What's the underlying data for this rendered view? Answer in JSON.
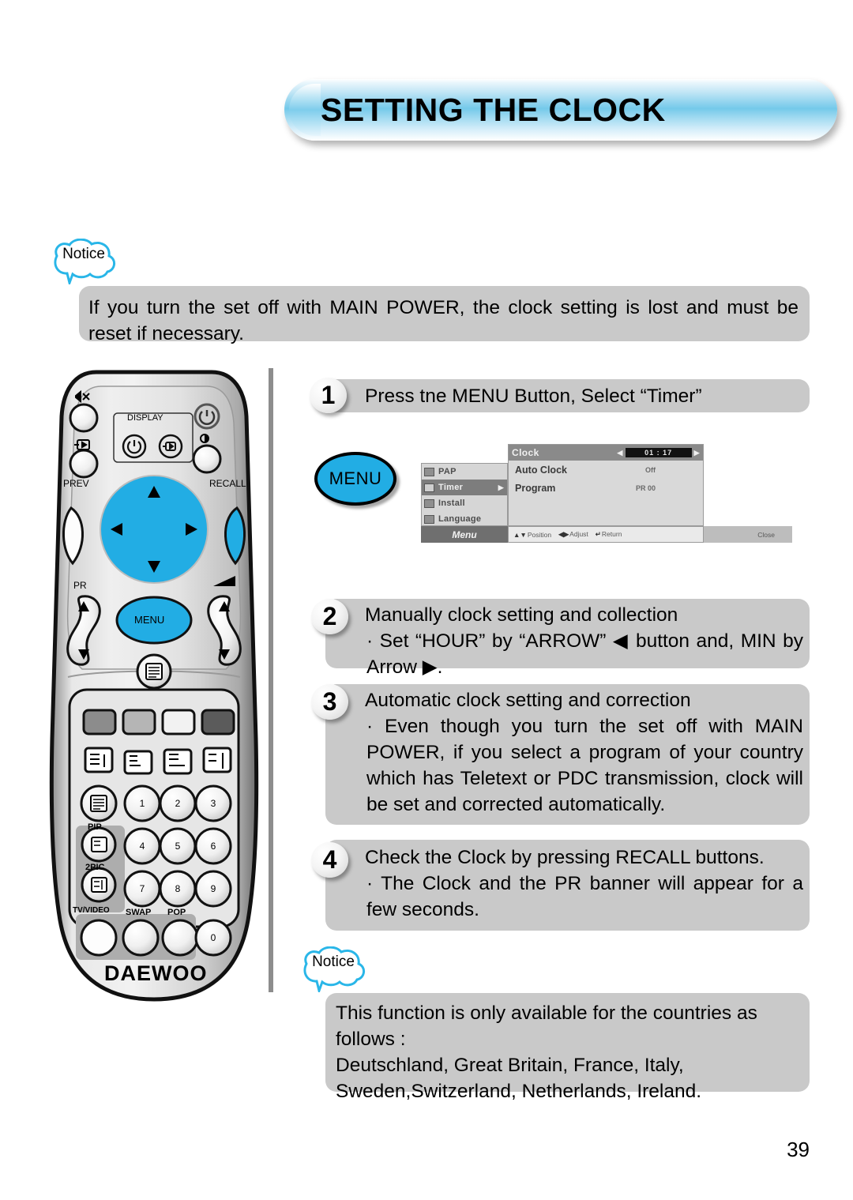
{
  "page": {
    "title": "SETTING THE CLOCK",
    "number": "39"
  },
  "notice_top": {
    "badge": "Notice",
    "text": "If you turn the set off with MAIN POWER, the clock setting is lost and must be reset if necessary."
  },
  "steps": [
    {
      "number": "1",
      "title": "Press tne MENU Button, Select “Timer”",
      "bullets": []
    },
    {
      "number": "2",
      "title": "Manually clock setting and collection",
      "bullets": [
        "· Set “HOUR” by “ARROW” ◀ button and, MIN by Arrow ▶."
      ]
    },
    {
      "number": "3",
      "title": "Automatic clock setting and correction",
      "bullets": [
        "· Even though you turn the set off with MAIN POWER, if you select a program of your country which has Teletext or PDC transmission, clock will be set  and corrected automatically."
      ]
    },
    {
      "number": "4",
      "title": "Check the Clock by pressing RECALL buttons.",
      "bullets": [
        "· The Clock and the PR banner will appear for a few seconds."
      ]
    }
  ],
  "notice_bottom": {
    "badge": "Notice",
    "line1": "This function is only available for the countries as follows :",
    "line2": "Deutschland, Great Britain, France, Italy,",
    "line3": "Sweden,Switzerland, Netherlands, Ireland."
  },
  "osd": {
    "menu_button_label": "MENU",
    "left_items": [
      {
        "label": "PAP",
        "selected": false,
        "submenu_arrow": ""
      },
      {
        "label": "Timer",
        "selected": true,
        "submenu_arrow": "▶"
      },
      {
        "label": "Install",
        "selected": false,
        "submenu_arrow": ""
      },
      {
        "label": "Language",
        "selected": false,
        "submenu_arrow": ""
      }
    ],
    "panel": {
      "title": "Clock",
      "clock_value": "01 : 17",
      "left_arrow": "◀",
      "right_arrow": "▶",
      "rows": [
        {
          "label": "Auto Clock",
          "value": "Off"
        },
        {
          "label": "Program",
          "value": "PR 00"
        }
      ]
    },
    "bottom_bar": {
      "menu_label": "Menu",
      "hint_position_keys": "▲▼",
      "hint_position": "Position",
      "hint_adjust_keys": "◀▶",
      "hint_adjust": "Adjust",
      "hint_return_keys": "↵",
      "hint_return": "Return",
      "close": "Close"
    }
  },
  "remote": {
    "brand": "DAEWOO",
    "labels": {
      "display": "DISPLAY",
      "prev": "PREV",
      "recall": "RECALL",
      "pr": "PR",
      "menu": "MENU",
      "pip": "PIP",
      "twopic": "2PIC",
      "tv_video": "TV/VIDEO",
      "swap": "SWAP",
      "pop": "POP"
    },
    "keypad": [
      "1",
      "2",
      "3",
      "4",
      "5",
      "6",
      "7",
      "8",
      "9",
      "0"
    ],
    "colors": {
      "accent_blue": "#22ade4",
      "body_gray": "#d8d8d8",
      "notice_cyan": "#29b6e8"
    }
  }
}
